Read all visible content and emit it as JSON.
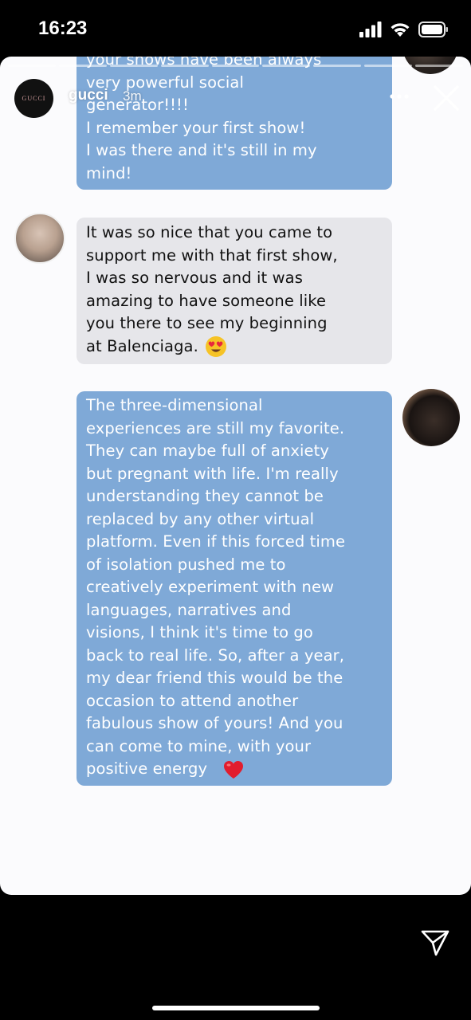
{
  "status_bar": {
    "time": "16:23"
  },
  "header": {
    "brand_logo_text": "GUCCI",
    "username": "gucci",
    "time_ago": "3m"
  },
  "messages": [
    {
      "side": "right",
      "text": "your shows have been always\nvery powerful social\ngenerator!!!!\nI remember your first show!\nI was there and it's still in my\nmind!"
    },
    {
      "side": "left",
      "text": "It was so nice that you came to\nsupport me with that first show,\nI was so nervous and it was\namazing to have someone like\nyou there to see my beginning\nat Balenciaga.",
      "emoji": "heart-eyes"
    },
    {
      "side": "right",
      "text": "The three-dimensional\nexperiences are still my favorite.\nThey can maybe full of anxiety\nbut pregnant with life. I'm really\nunderstanding they cannot be\nreplaced by any other virtual\nplatform. Even if this forced time\nof isolation pushed me to\ncreatively experiment with new\nlanguages, narratives and\nvisions, I think it's time to go\nback to real life. So, after a year,\nmy dear friend this would be the\noccasion to attend another\nfabulous show of yours! And you\ncan come to mine, with your\npositive energy",
      "emoji": "red-heart"
    }
  ],
  "colors": {
    "blue_bubble": "#7fa9d7",
    "gray_bubble": "#e6e6ea",
    "story_background": "#fbfbfd"
  },
  "icons": [
    "signal-icon",
    "wifi-icon",
    "battery-icon",
    "more-icon",
    "close-icon",
    "send-icon"
  ]
}
